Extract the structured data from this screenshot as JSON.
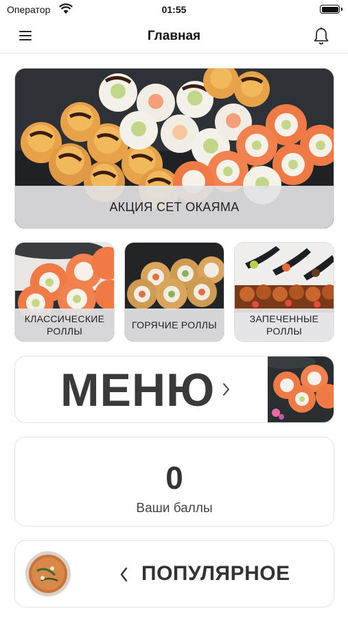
{
  "status_bar": {
    "carrier": "Оператор",
    "time": "01:55",
    "icons": [
      "wifi-icon",
      "battery-icon"
    ]
  },
  "nav": {
    "title": "Главная",
    "left_icon": "hamburger-menu-icon",
    "right_icon": "bell-icon"
  },
  "promo": {
    "caption": "АКЦИЯ СЕТ ОКАЯМА"
  },
  "categories": [
    {
      "label": "КЛАССИЧЕСКИЕ РОЛЛЫ"
    },
    {
      "label": "ГОРЯЧИЕ РОЛЛЫ"
    },
    {
      "label": "ЗАПЕЧЕННЫЕ РОЛЛЫ"
    }
  ],
  "menu_card": {
    "label": "МЕНЮ",
    "icon": "chevron-right-icon"
  },
  "points": {
    "value": "0",
    "label": "Ваши баллы"
  },
  "popular": {
    "label": "ПОПУЛЯРНОЕ",
    "icon": "chevron-left-icon"
  },
  "colors": {
    "background": "#ffffff",
    "caption_overlay": "#e2e2e4",
    "text_dark": "#333333",
    "salmon": "#f07a45"
  }
}
